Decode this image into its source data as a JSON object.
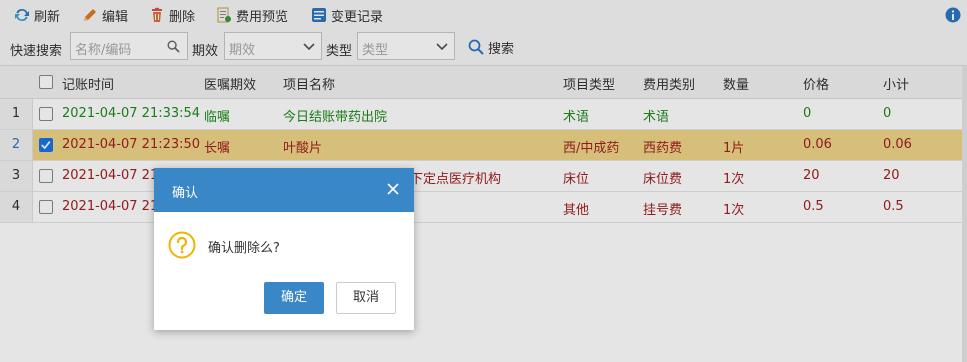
{
  "toolbar": {
    "refresh": "刷新",
    "edit": "编辑",
    "delete": "删除",
    "preview_fee": "费用预览",
    "change_log": "变更记录"
  },
  "filter": {
    "quick_search_label": "快速搜索",
    "quick_search_placeholder": "名称/编码",
    "period_label": "期效",
    "period_placeholder": "期效",
    "type_label": "类型",
    "type_placeholder": "类型",
    "search_button": "搜索"
  },
  "grid": {
    "headers": {
      "time": "记账时间",
      "period": "医嘱期效",
      "name": "项目名称",
      "item_type": "项目类型",
      "fee_type": "费用类别",
      "qty": "数量",
      "price": "价格",
      "subtotal": "小计"
    },
    "rows": [
      {
        "num": "1",
        "time": "2021-04-07 21:33:54",
        "period": "临嘱",
        "name": "今日结账带药出院",
        "item_type": "术语",
        "fee_type": "术语",
        "qty": "",
        "price": "0",
        "subtotal": "0",
        "checked": false
      },
      {
        "num": "2",
        "time": "2021-04-07 21:23:50",
        "period": "长嘱",
        "name": "叶酸片",
        "item_type": "西/中成药",
        "fee_type": "西药费",
        "qty": "1片",
        "price": "0.06",
        "subtotal": "0.06",
        "checked": true
      },
      {
        "num": "3",
        "time": "2021-04-07 21",
        "period": "",
        "name": "下定点医疗机构",
        "item_type": "床位",
        "fee_type": "床位费",
        "qty": "1次",
        "price": "20",
        "subtotal": "20",
        "checked": false
      },
      {
        "num": "4",
        "time": "2021-04-07 21",
        "period": "",
        "name": "",
        "item_type": "其他",
        "fee_type": "挂号费",
        "qty": "1次",
        "price": "0.5",
        "subtotal": "0.5",
        "checked": false
      }
    ]
  },
  "dialog": {
    "title": "确认",
    "message": "确认删除么?",
    "ok": "确定",
    "cancel": "取消"
  },
  "colors": {
    "accent": "#3a87c7",
    "selected_row": "#efd58a",
    "green_text": "#1e8b1e",
    "red_text": "#a32020"
  }
}
